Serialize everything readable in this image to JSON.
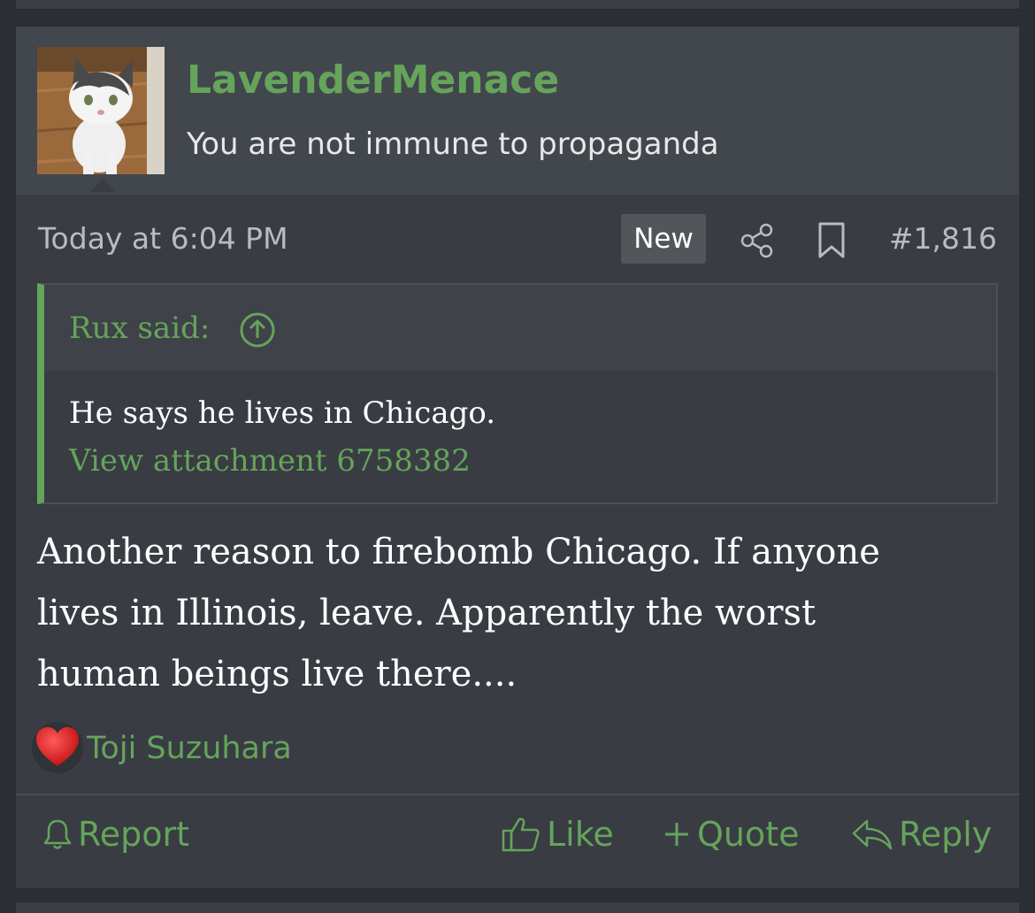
{
  "post": {
    "username": "LavenderMenace",
    "user_title": "You are not immune to propaganda",
    "date": "Today at 6:04 PM",
    "badge": "New",
    "number": "#1,816",
    "quote": {
      "author": "Rux said:",
      "text": "He says he lives in Chicago.",
      "attachment": "View attachment 6758382"
    },
    "body_lines": [
      "Another reason to firebomb Chicago. If anyone",
      "lives in Illinois, leave. Apparently the worst",
      "human beings live there...."
    ],
    "reaction": {
      "icon": "heart-icon",
      "user": "Toji Suzuhara"
    },
    "actions": {
      "report": "Report",
      "like": "Like",
      "quote": "Quote",
      "reply": "Reply"
    }
  },
  "colors": {
    "accent": "#65a45a",
    "background": "#2b2e34",
    "post_bg": "#393c43",
    "user_block_bg": "#42464d"
  }
}
